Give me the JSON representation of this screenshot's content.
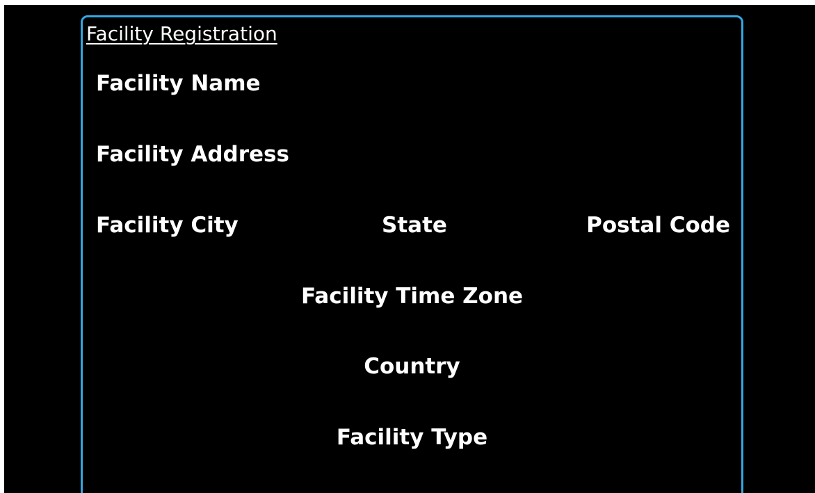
{
  "form": {
    "title": "Facility Registration",
    "accent_color": "#35a7e0",
    "background_color": "#000000",
    "text_color": "#ffffff",
    "fields": {
      "facility_name": "Facility Name",
      "facility_address": "Facility Address",
      "facility_city": "Facility City",
      "state": "State",
      "postal_code": "Postal Code",
      "facility_time_zone": "Facility Time Zone",
      "country": "Country",
      "facility_type": "Facility Type"
    }
  }
}
